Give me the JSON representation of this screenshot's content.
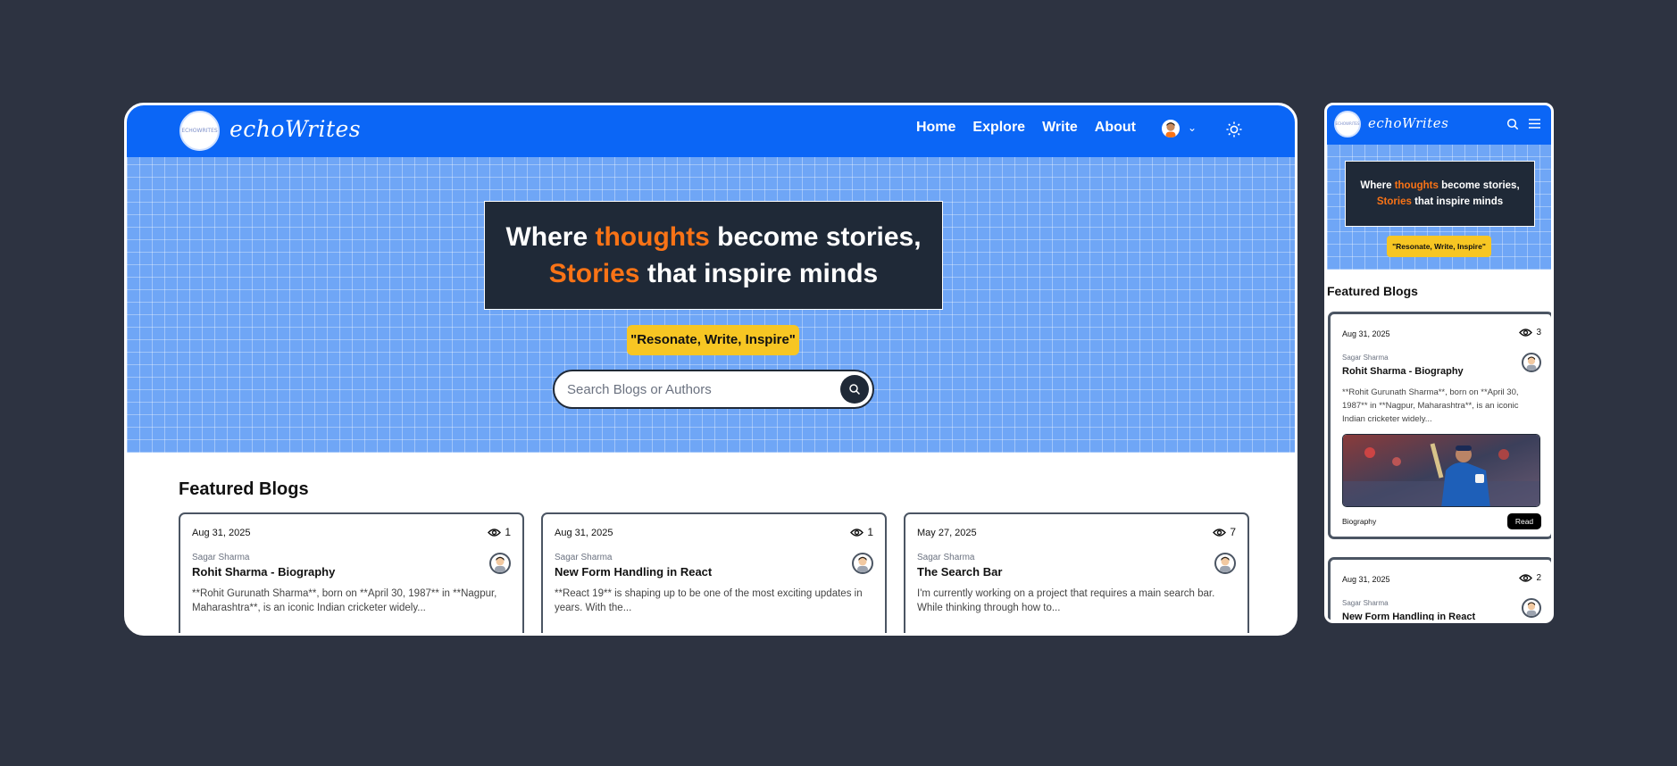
{
  "brand": {
    "name": "echoWrites",
    "logo_text": "ECHOWRITES"
  },
  "nav": {
    "links": [
      "Home",
      "Explore",
      "Write",
      "About"
    ]
  },
  "hero": {
    "line1_pre": "Where ",
    "line1_accent": "thoughts",
    "line1_post": " become stories,",
    "line2_accent": "Stories",
    "line2_post": " that inspire minds",
    "motto": "\"Resonate, Write, Inspire\"",
    "search_placeholder": "Search Blogs or Authors"
  },
  "featured": {
    "title": "Featured Blogs",
    "cards": [
      {
        "date": "Aug 31, 2025",
        "views": "1",
        "author": "Sagar Sharma",
        "title": "Rohit Sharma - Biography",
        "excerpt": "**Rohit Gurunath Sharma**, born on **April 30, 1987** in **Nagpur, Maharashtra**, is an iconic Indian cricketer widely..."
      },
      {
        "date": "Aug 31, 2025",
        "views": "1",
        "author": "Sagar Sharma",
        "title": "New Form Handling in React",
        "excerpt": "**React 19** is shaping up to be one of the most exciting updates in years. With the..."
      },
      {
        "date": "May 27, 2025",
        "views": "7",
        "author": "Sagar Sharma",
        "title": "The Search Bar",
        "excerpt": "I'm currently working on a project that requires a main search bar. While thinking through how to..."
      }
    ]
  },
  "mobile": {
    "cards": [
      {
        "date": "Aug 31, 2025",
        "views": "3",
        "author": "Sagar Sharma",
        "title": "Rohit Sharma - Biography",
        "excerpt": "**Rohit Gurunath Sharma**, born on **April 30, 1987** in **Nagpur, Maharashtra**, is an iconic Indian cricketer widely...",
        "category": "Biography",
        "read_label": "Read"
      },
      {
        "date": "Aug 31, 2025",
        "views": "2",
        "author": "Sagar Sharma",
        "title": "New Form Handling in React"
      }
    ]
  },
  "colors": {
    "nav": "#0b66f6",
    "accent": "#f97316",
    "motto": "#f7c623",
    "dark": "#1f2937",
    "background": "#2d3341"
  }
}
